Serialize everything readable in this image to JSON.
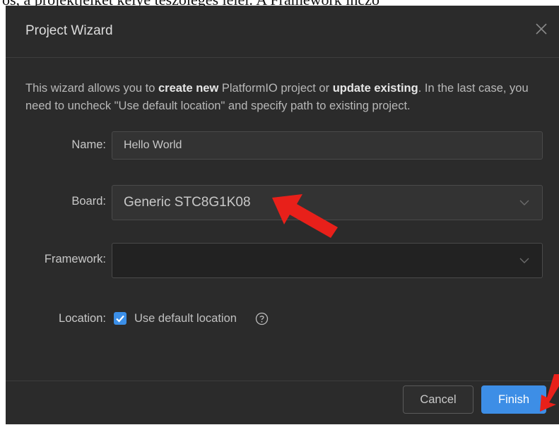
{
  "background_text": "os, a projektjeiket kelye teszolegés léiéi. A Framework incző",
  "dialog": {
    "title": "Project Wizard",
    "description": {
      "part1": "This wizard allows you to ",
      "bold1": "create new",
      "part2": " PlatformIO project or ",
      "bold2": "update existing",
      "part3": ". In the last case, you need to uncheck \"Use default location\" and specify path to existing project."
    },
    "fields": {
      "name_label": "Name:",
      "name_value": "Hello World",
      "board_label": "Board:",
      "board_value": "Generic STC8G1K08",
      "framework_label": "Framework:",
      "framework_value": "",
      "location_label": "Location:",
      "use_default_location_label": "Use default location",
      "use_default_location_checked": true
    },
    "buttons": {
      "cancel": "Cancel",
      "finish": "Finish"
    }
  },
  "colors": {
    "dialog_bg": "#2b2b2b",
    "input_bg": "#333333",
    "accent": "#3d8ee6",
    "annotation_arrow": "#e8201a"
  },
  "icons": [
    "close-icon",
    "chevron-down-icon",
    "checkmark-icon",
    "help-icon"
  ]
}
